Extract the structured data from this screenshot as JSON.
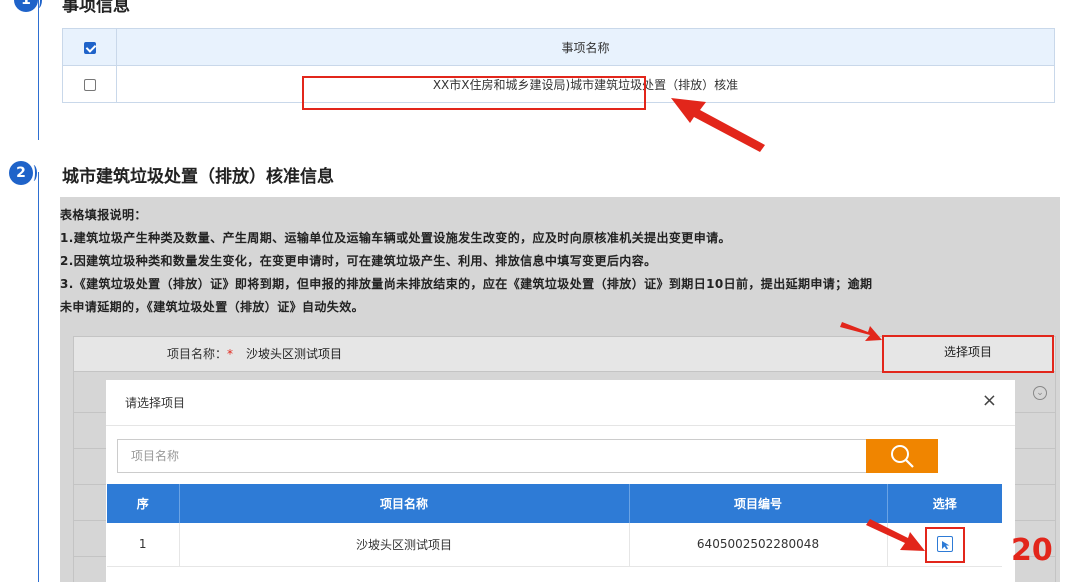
{
  "section1": {
    "badge": "1",
    "title": "事项信息",
    "table": {
      "header": "事项名称",
      "rows": [
        {
          "name": "XX市X住房和城乡建设局)城市建筑垃圾处置（排放）核准"
        }
      ]
    }
  },
  "section2": {
    "badge": "2",
    "title": "城市建筑垃圾处置（排放）核准信息",
    "notes": [
      "表格填报说明：",
      "1.建筑垃圾产生种类及数量、产生周期、运输单位及运输车辆或处置设施发生改变的，应及时向原核准机关提出变更申请。",
      "2.因建筑垃圾种类和数量发生变化，在变更申请时，可在建筑垃圾产生、利用、排放信息中填写变更后内容。",
      "3.《建筑垃圾处置（排放）证》即将到期，但申报的排放量尚未排放结束的，应在《建筑垃圾处置（排放）证》到期日10日前，提出延期申请；逾期",
      "未申请延期的，《建筑垃圾处置（排放）证》自动失效。"
    ],
    "form": {
      "project_label": "项目名称：",
      "required_mark": "*",
      "project_value": "沙坡头区测试项目",
      "choose_button": "选择项目"
    }
  },
  "modal": {
    "title": "请选择项目",
    "close": "×",
    "search_placeholder": "项目名称",
    "columns": [
      "序",
      "项目名称",
      "项目编号",
      "选择"
    ],
    "rows": [
      {
        "index": "1",
        "name": "沙坡头区测试项目",
        "code": "6405002502280048"
      }
    ]
  },
  "annotation": {
    "step_number": "20"
  },
  "colors": {
    "accent": "#1f63c9",
    "header_blue": "#2e7bd6",
    "search_orange": "#f08500",
    "highlight_red": "#e2261b"
  }
}
